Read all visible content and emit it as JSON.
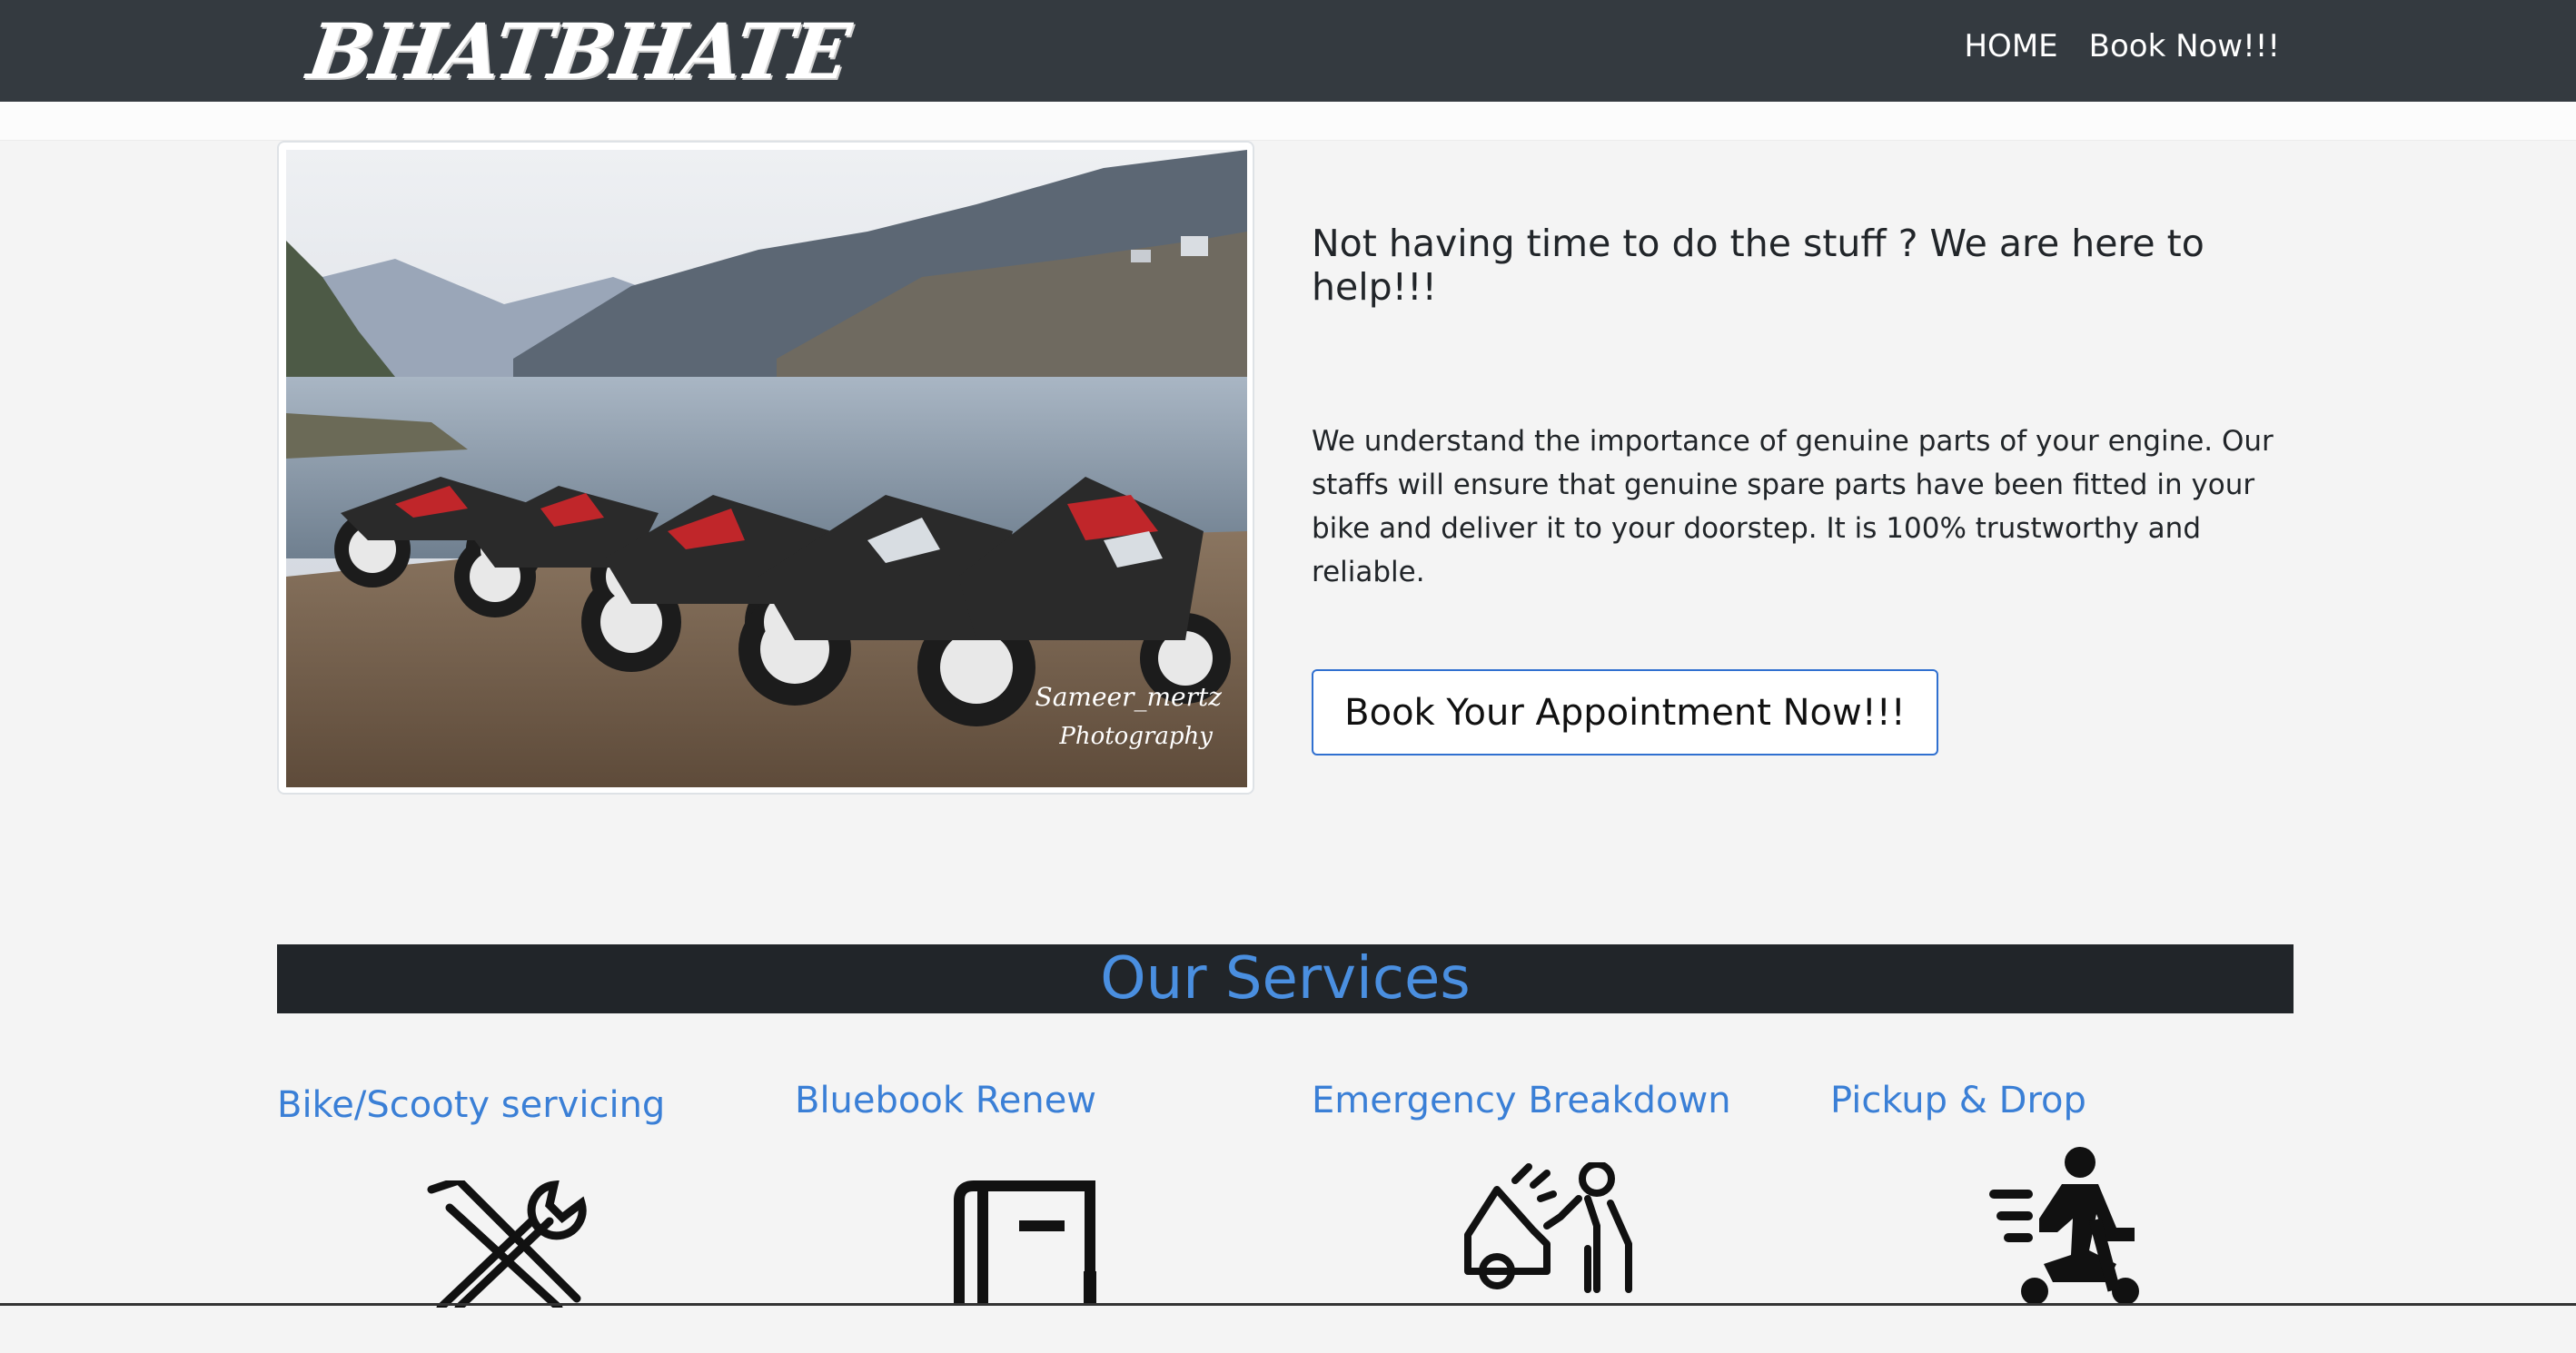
{
  "brand": {
    "logo_text": "BHATBHATE"
  },
  "nav": {
    "home": "HOME",
    "book": "Book Now!!!"
  },
  "hero": {
    "image_caption_line1": "Sameer_mertz",
    "image_caption_line2": "Photography",
    "heading": "Not having time to do the stuff ? We are here to help!!!",
    "body": "We understand the importance of genuine parts of your engine. Our staffs will ensure that genuine spare parts have been fitted in your bike and deliver it to your doorstep. It is 100% trustworthy and reliable.",
    "cta": "Book Your Appointment Now!!!"
  },
  "services": {
    "title": "Our Services",
    "items": [
      {
        "title": "Bike/Scooty servicing",
        "icon": "wrench-screwdriver-icon"
      },
      {
        "title": "Bluebook Renew",
        "icon": "book-icon"
      },
      {
        "title": "Emergency Breakdown",
        "icon": "car-breakdown-icon"
      },
      {
        "title": "Pickup & Drop",
        "icon": "scooter-delivery-icon"
      }
    ]
  },
  "colors": {
    "navbar": "#343a40",
    "services_bar": "#212529",
    "accent": "#3a7fd6",
    "page_bg": "#f4f4f4"
  }
}
